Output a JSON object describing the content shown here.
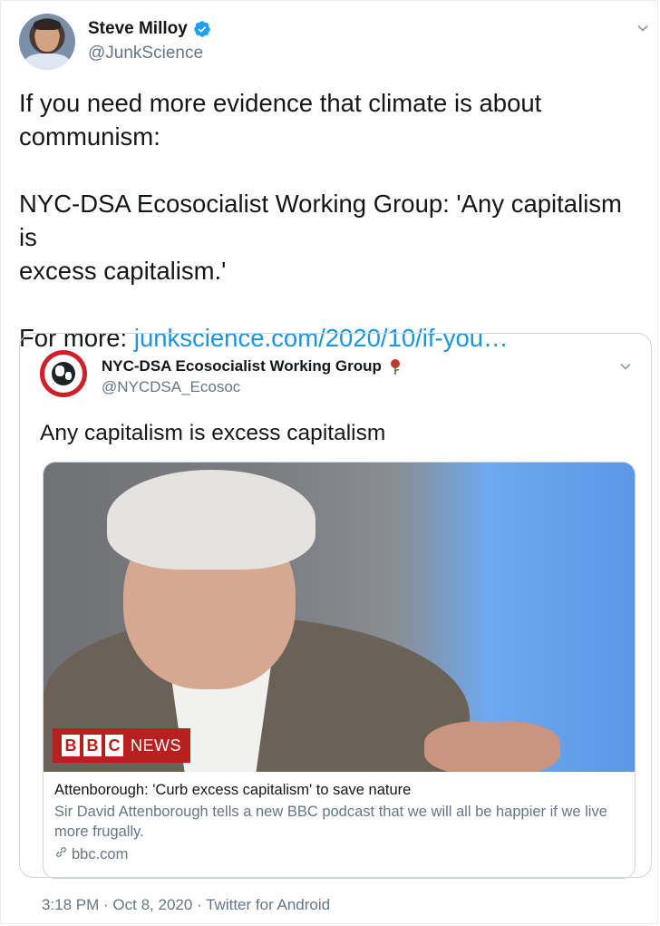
{
  "tweet": {
    "display_name": "Steve Milloy",
    "handle": "@JunkScience",
    "verified": true,
    "body_line1": "If you need more evidence that climate is about",
    "body_line2": "communism:",
    "body_line3": "NYC-DSA Ecosocialist Working Group: 'Any capitalism is",
    "body_line4": "excess capitalism.'",
    "body_more_prefix": "For more: ",
    "body_link": "junkscience.com/2020/10/if-you…",
    "timestamp": "3:18 PM · Oct 8, 2020 · Twitter for Android"
  },
  "quoted": {
    "display_name": "NYC-DSA Ecosocialist Working Group",
    "handle": "@NYCDSA_Ecosoc",
    "text": "Any capitalism is excess capitalism",
    "card": {
      "logo_letters": [
        "B",
        "B",
        "C"
      ],
      "logo_news": "NEWS",
      "title": "Attenborough: 'Curb excess capitalism' to save nature",
      "description": "Sir David Attenborough tells a new BBC podcast that we will all be happier if we live more frugally.",
      "domain": "bbc.com"
    }
  },
  "colors": {
    "link": "#1b95e0",
    "verified": "#1da1f2",
    "secondary_text": "#657786",
    "bbc_red": "#b91f1f"
  }
}
